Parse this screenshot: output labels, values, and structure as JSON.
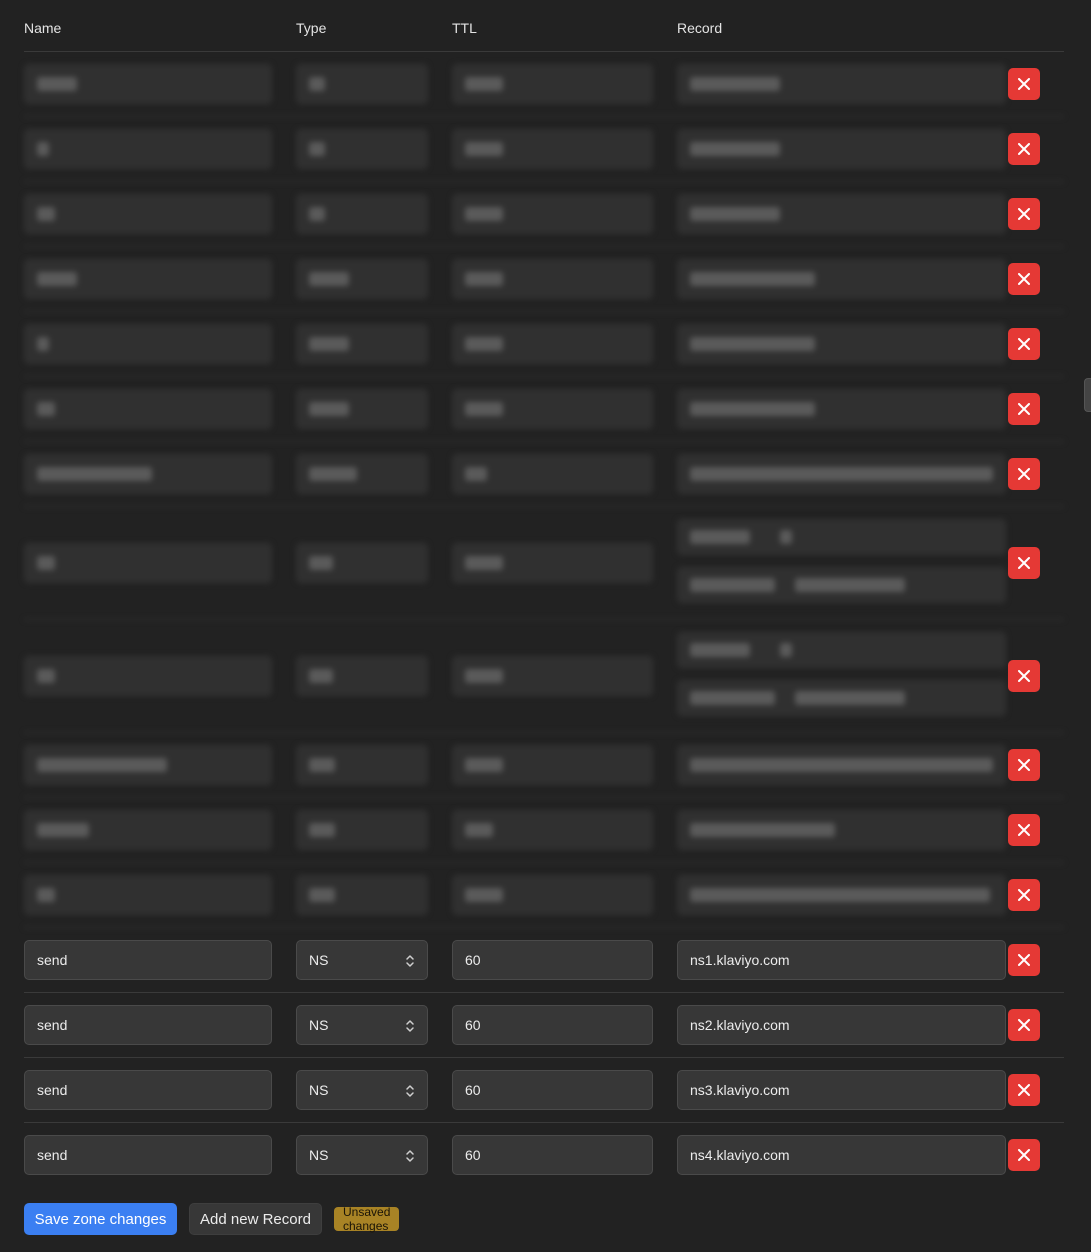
{
  "table": {
    "headers": {
      "name": "Name",
      "type": "Type",
      "ttl": "TTL",
      "record": "Record"
    }
  },
  "visible_records": [
    {
      "name": "send",
      "type": "NS",
      "ttl": "60",
      "record": "ns1.klaviyo.com"
    },
    {
      "name": "send",
      "type": "NS",
      "ttl": "60",
      "record": "ns2.klaviyo.com"
    },
    {
      "name": "send",
      "type": "NS",
      "ttl": "60",
      "record": "ns3.klaviyo.com"
    },
    {
      "name": "send",
      "type": "NS",
      "ttl": "60",
      "record": "ns4.klaviyo.com"
    }
  ],
  "icons": {
    "delete": "close-icon",
    "select": "chevron-up-down-icon"
  },
  "footer": {
    "save_label": "Save zone changes",
    "add_label": "Add new Record",
    "status_badge": "Unsaved changes"
  },
  "colors": {
    "background": "#222222",
    "field": "#373737",
    "delete": "#e53935",
    "primary": "#3b7ff2",
    "badge": "#a88325"
  }
}
